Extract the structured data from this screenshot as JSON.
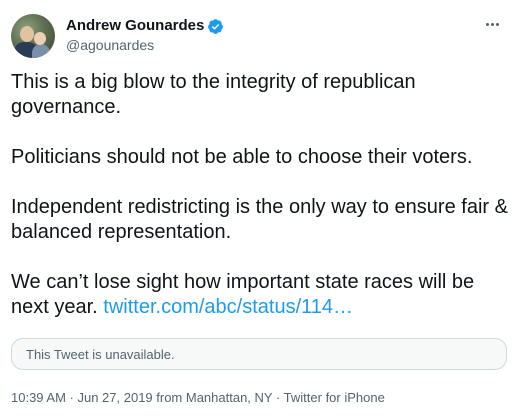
{
  "author": {
    "name": "Andrew Gounardes",
    "handle": "@agounardes",
    "verified": true,
    "verified_color": "#1d9bf0"
  },
  "tweet": {
    "paragraphs": [
      "This is a big blow to the integrity of republican governance.",
      "Politicians should not be able to choose their voters.",
      "Independent redistricting is the only way to ensure fair & balanced representation."
    ],
    "last_paragraph_text": "We can’t lose sight how important state races will be next year. ",
    "link_text": "twitter.com/abc/status/114…",
    "link_color": "#1d9bf0"
  },
  "quoted": {
    "unavailable_text": "This Tweet is unavailable."
  },
  "meta": {
    "time": "10:39 AM",
    "date": "Jun 27, 2019",
    "location": "from Manhattan, NY",
    "source": "Twitter for iPhone",
    "full": "10:39 AM · Jun 27, 2019 from Manhattan, NY · Twitter for iPhone"
  },
  "icons": {
    "verified": "verified-badge-icon",
    "more": "more-options-icon"
  }
}
